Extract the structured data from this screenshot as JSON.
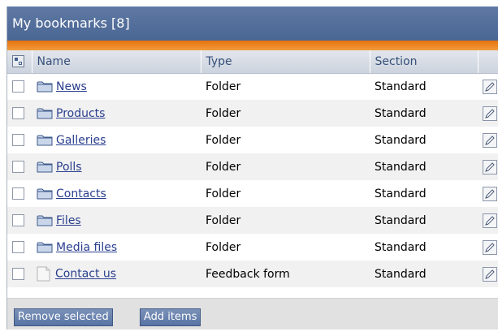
{
  "header": {
    "title": "My bookmarks [8]"
  },
  "table": {
    "columns": [
      "Name",
      "Type",
      "Section"
    ],
    "rows": [
      {
        "name": "News",
        "type": "Folder",
        "section": "Standard",
        "icon": "folder-icon"
      },
      {
        "name": "Products",
        "type": "Folder",
        "section": "Standard",
        "icon": "folder-icon"
      },
      {
        "name": "Galleries",
        "type": "Folder",
        "section": "Standard",
        "icon": "folder-icon"
      },
      {
        "name": "Polls",
        "type": "Folder",
        "section": "Standard",
        "icon": "folder-icon"
      },
      {
        "name": "Contacts",
        "type": "Folder",
        "section": "Standard",
        "icon": "folder-icon"
      },
      {
        "name": "Files",
        "type": "Folder",
        "section": "Standard",
        "icon": "folder-icon"
      },
      {
        "name": "Media files",
        "type": "Folder",
        "section": "Standard",
        "icon": "folder-icon"
      },
      {
        "name": "Contact us",
        "type": "Feedback form",
        "section": "Standard",
        "icon": "document-icon"
      }
    ]
  },
  "footer": {
    "remove_label": "Remove selected",
    "add_label": "Add items"
  },
  "colors": {
    "header_blue": "#4a6693",
    "accent_orange": "#e6730e",
    "link_blue": "#2a3f8e"
  }
}
